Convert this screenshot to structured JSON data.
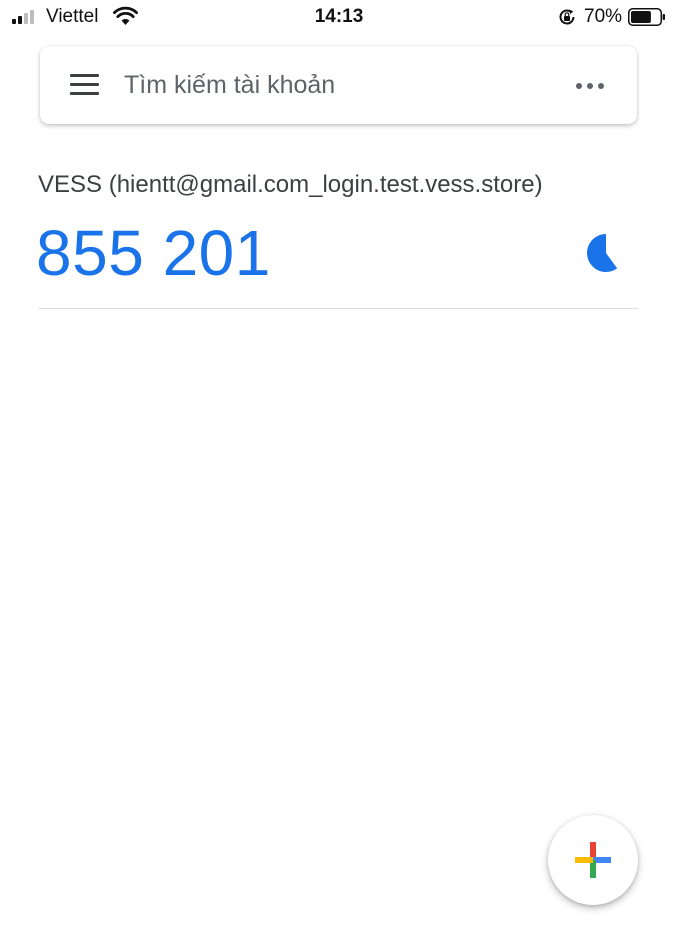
{
  "status_bar": {
    "carrier": "Viettel",
    "time": "14:13",
    "battery_percent": "70%",
    "signal_bars_active": 2,
    "signal_bars_total": 4,
    "battery_level": 0.7,
    "icons": [
      "signal-icon",
      "wifi-icon",
      "rotation-lock-icon",
      "battery-icon"
    ]
  },
  "search": {
    "placeholder": "Tìm kiếm tài khoản",
    "menu_icon": "hamburger-menu-icon",
    "more_icon": "more-horizontal-icon"
  },
  "accounts": [
    {
      "label": "VESS (hientt@gmail.com_login.test.vess.store)",
      "code": "855 201",
      "timer_icon": "countdown-timer-icon",
      "timer_remaining_fraction": 0.6,
      "code_color": "#1a73e8"
    }
  ],
  "fab": {
    "icon": "add-icon",
    "colors": {
      "red": "#ea4335",
      "blue": "#4285f4",
      "yellow": "#fbbc04",
      "green": "#34a853"
    }
  }
}
